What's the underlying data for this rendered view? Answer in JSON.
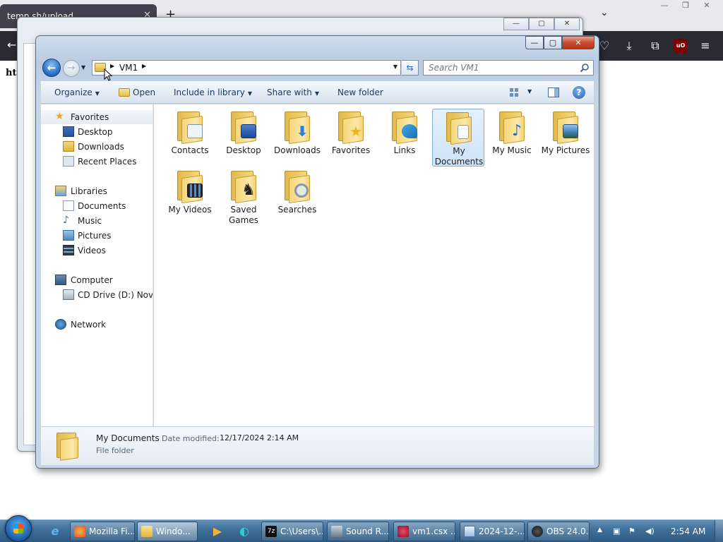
{
  "browser": {
    "tab_title": "temp.sh/upload",
    "tab_close": "✕",
    "new_tab": "+",
    "content_text": "htt"
  },
  "explorer": {
    "address": {
      "segment": "VM1"
    },
    "search": {
      "placeholder": "Search VM1"
    },
    "commands": {
      "organize": "Organize",
      "open": "Open",
      "include_in_library": "Include in library",
      "share_with": "Share with",
      "new_folder": "New folder"
    },
    "nav": {
      "favorites": "Favorites",
      "desktop": "Desktop",
      "downloads": "Downloads",
      "recent_places": "Recent Places",
      "libraries": "Libraries",
      "documents": "Documents",
      "music": "Music",
      "pictures": "Pictures",
      "videos": "Videos",
      "computer": "Computer",
      "cd_drive": "CD Drive (D:) Novide",
      "network": "Network"
    },
    "items": [
      {
        "name": "Contacts",
        "emblem": "contact-card-icon"
      },
      {
        "name": "Desktop",
        "emblem": "desktop-icon"
      },
      {
        "name": "Downloads",
        "emblem": "download-arrow-icon"
      },
      {
        "name": "Favorites",
        "emblem": "star-icon"
      },
      {
        "name": "Links",
        "emblem": "link-arrow-icon"
      },
      {
        "name": "My Documents",
        "emblem": "document-icon",
        "selected": true
      },
      {
        "name": "My Music",
        "emblem": "music-note-icon"
      },
      {
        "name": "My Pictures",
        "emblem": "picture-icon"
      },
      {
        "name": "My Videos",
        "emblem": "film-icon"
      },
      {
        "name": "Saved Games",
        "emblem": "chess-piece-icon"
      },
      {
        "name": "Searches",
        "emblem": "magnifier-icon"
      }
    ],
    "details": {
      "name": "My Documents",
      "date_label": "Date modified:",
      "date_value": "12/17/2024 2:14 AM",
      "type": "File folder"
    }
  },
  "taskbar": {
    "buttons": [
      {
        "label": "Mozilla Fi...",
        "icon": "firefox-icon"
      },
      {
        "label": "Windo...",
        "icon": "explorer-icon"
      },
      {
        "label": "C:\\Users\\...",
        "icon": "7zip-icon"
      },
      {
        "label": "Sound R...",
        "icon": "microphone-icon"
      },
      {
        "label": "vm1.csx ...",
        "icon": "script-icon"
      },
      {
        "label": "2024-12-...",
        "icon": "notepad-icon"
      },
      {
        "label": "OBS 24.0....",
        "icon": "obs-icon"
      }
    ],
    "clock": "2:54 AM"
  }
}
